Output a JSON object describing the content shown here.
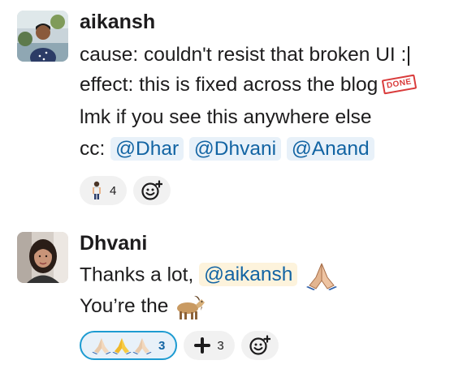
{
  "messages": [
    {
      "author": "aikansh",
      "lines": {
        "l1": "cause: couldn't resist that broken UI :",
        "l2": "effect: this is fixed across the blog",
        "l2_badge": "DONE",
        "l3": "lmk if you see this anywhere else",
        "l4_prefix": "cc:"
      },
      "mentions": [
        "@Dhar",
        "@Dhvani",
        "@Anand"
      ],
      "reactions": [
        {
          "emoji_name": "person-standing-icon",
          "count": "4"
        }
      ]
    },
    {
      "author": "Dhvani",
      "lines": {
        "l1_prefix": "Thanks a lot,",
        "l1_mention": "@aikansh",
        "l2": "You’re the"
      },
      "reactions": [
        {
          "emoji_name": "folded-hands-icon",
          "count": "3",
          "active": true
        },
        {
          "emoji_name": "heavy-plus-icon",
          "count": "3"
        }
      ]
    }
  ],
  "colors": {
    "mention_text": "#1264a3",
    "mention_bg": "#e8f1f9",
    "self_mention_bg": "#fdf3dc",
    "active_reaction_border": "#1d9bd1"
  }
}
